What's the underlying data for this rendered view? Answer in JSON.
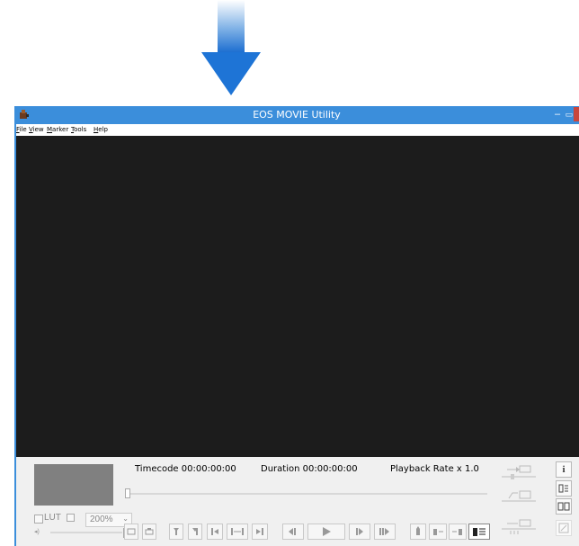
{
  "window": {
    "title": "EOS MOVIE Utility"
  },
  "menu": [
    {
      "accel": "F",
      "rest": "ile"
    },
    {
      "accel": "V",
      "rest": "iew"
    },
    {
      "accel": "M",
      "rest": "arker"
    },
    {
      "accel": "T",
      "rest": "ools"
    },
    {
      "accel": "H",
      "rest": "elp"
    }
  ],
  "info": {
    "timecode": "Timecode 00:00:00:00",
    "duration": "Duration 00:00:00:00",
    "rate": "Playback Rate x 1.0"
  },
  "lut": {
    "label": "LUT"
  },
  "zoom": {
    "value": "200%"
  },
  "side": {
    "info_glyph": "i"
  },
  "icons": [
    "arrow-down-icon",
    "app-icon",
    "minimize-icon",
    "maximize-icon",
    "close-icon",
    "volume-icon",
    "info-icon"
  ],
  "colors": {
    "titlebar": "#3b8edb",
    "viewer": "#1c1c1c",
    "close": "#c9463d",
    "thumbnail": "#808080"
  }
}
